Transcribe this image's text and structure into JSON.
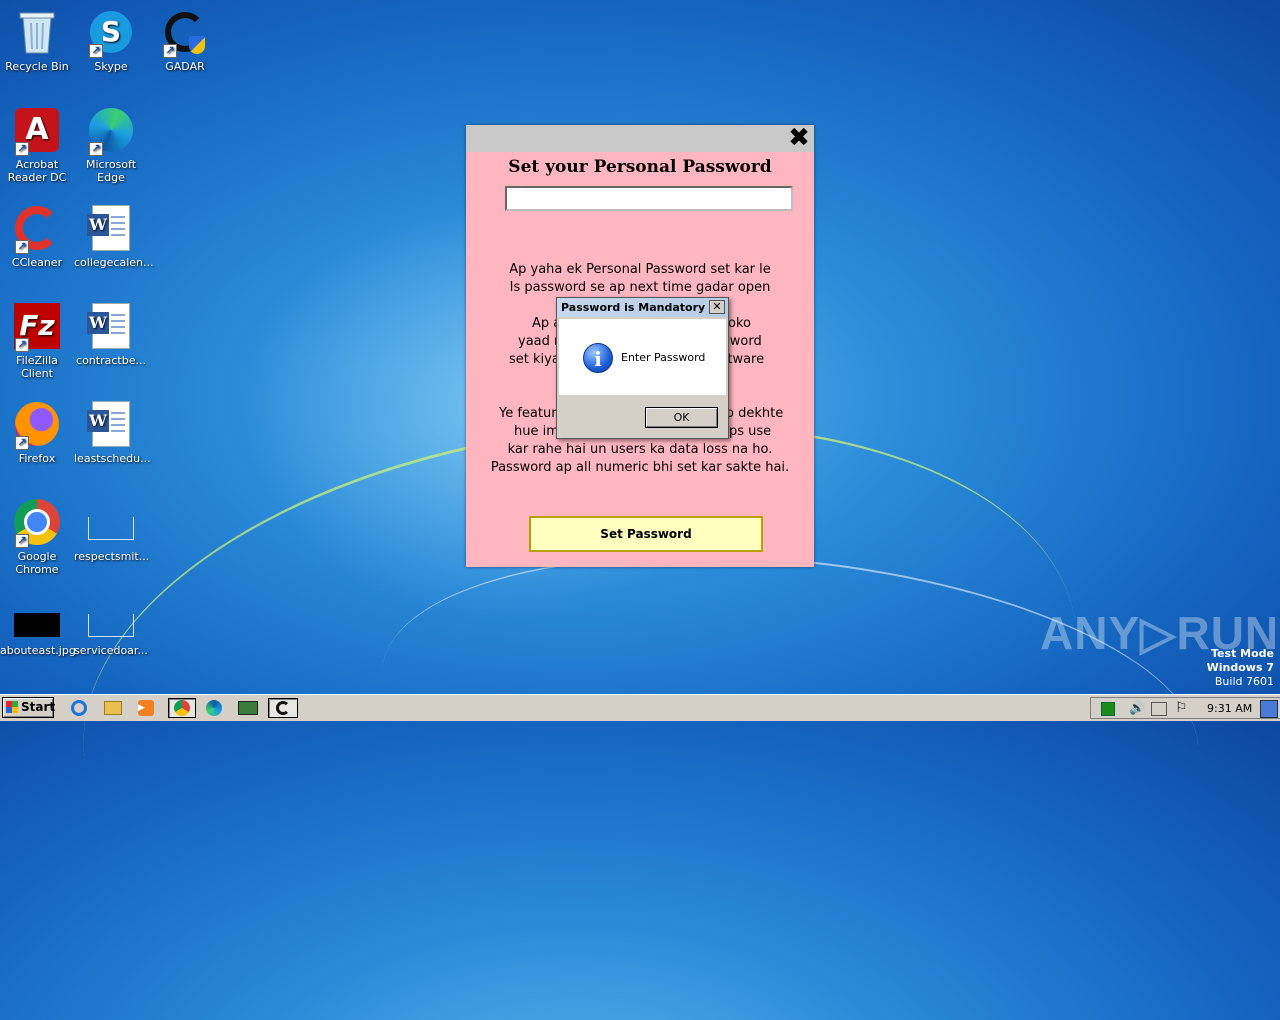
{
  "desktop": {
    "icons": [
      {
        "label": "Recycle Bin",
        "icon": "recycle-bin-icon"
      },
      {
        "label": "Skype",
        "icon": "skype-icon"
      },
      {
        "label": "GADAR",
        "icon": "gadar-icon"
      },
      {
        "label": "Acrobat Reader DC",
        "icon": "acrobat-icon"
      },
      {
        "label": "Microsoft Edge",
        "icon": "edge-icon"
      },
      {
        "label": "CCleaner",
        "icon": "ccleaner-icon"
      },
      {
        "label": "collegecalen...",
        "icon": "word-document-icon"
      },
      {
        "label": "FileZilla Client",
        "icon": "filezilla-icon"
      },
      {
        "label": "contractbe...",
        "icon": "word-document-icon"
      },
      {
        "label": "Firefox",
        "icon": "firefox-icon"
      },
      {
        "label": "leastschedu...",
        "icon": "word-document-icon"
      },
      {
        "label": "Google Chrome",
        "icon": "chrome-icon"
      },
      {
        "label": "respectsmit...",
        "icon": "blank-file-icon"
      },
      {
        "label": "abouteast.jpg",
        "icon": "image-file-icon"
      },
      {
        "label": "servicedoar...",
        "icon": "blank-file-icon"
      }
    ]
  },
  "gadar_window": {
    "close_glyph": "✖",
    "heading": "Set your Personal Password",
    "password_value": "",
    "para1": [
      "Ap yaha ek Personal Password set kar le",
      "Is password se ap next time gadar open"
    ],
    "para2": [
      "Ap a",
      "oko",
      "yaad r",
      "sword",
      "set kiya",
      "ftware"
    ],
    "para3": [
      "Ye featur",
      "o dekhte",
      "hue im",
      "ps use",
      "kar rahe hai un users ka data loss na ho.",
      "Password ap all numeric bhi set kar sakte hai."
    ],
    "set_button": "Set Password",
    "background": "#ffb6c1"
  },
  "message_box": {
    "title": "Password is Mandatory",
    "close_glyph": "✕",
    "icon_glyph": "i",
    "message": "Enter Password",
    "ok_button": "OK"
  },
  "watermark": {
    "text": "ANY▷RUN",
    "test_mode": "Test Mode",
    "os": "Windows 7",
    "build": "Build 7601"
  },
  "taskbar": {
    "start_label": "Start",
    "clock": "9:31 AM"
  }
}
